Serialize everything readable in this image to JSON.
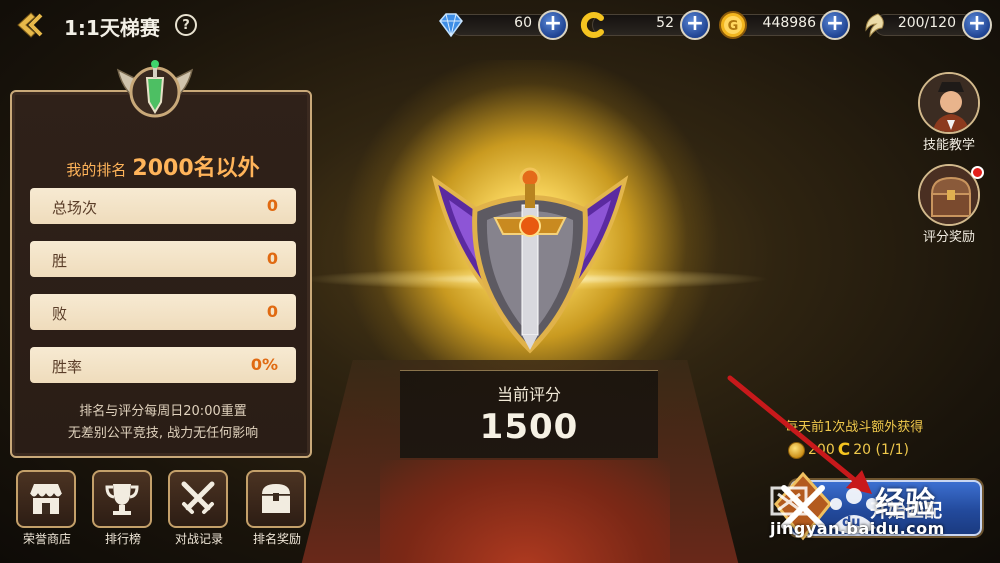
{
  "header": {
    "title": "1:1天梯赛",
    "help_label": "?"
  },
  "resources": [
    {
      "icon": "diamond-icon",
      "value": "60"
    },
    {
      "icon": "c-currency-icon",
      "value": "52"
    },
    {
      "icon": "gold-coin-icon",
      "value": "448986"
    },
    {
      "icon": "wing-stamina-icon",
      "value": "200/120"
    }
  ],
  "panel": {
    "rank_label": "我的排名",
    "rank_value": "2000名以外",
    "stats": [
      {
        "label": "总场次",
        "value": "0"
      },
      {
        "label": "胜",
        "value": "0"
      },
      {
        "label": "败",
        "value": "0"
      },
      {
        "label": "胜率",
        "value": "0%"
      }
    ],
    "notice_line1": "排名与评分每周日20:00重置",
    "notice_line2": "无差别公平竞技, 战力无任何影响"
  },
  "bottom_buttons": [
    {
      "label": "荣誉商店",
      "icon": "shop-icon"
    },
    {
      "label": "排行榜",
      "icon": "trophy-icon"
    },
    {
      "label": "对战记录",
      "icon": "crossed-swords-icon"
    },
    {
      "label": "排名奖励",
      "icon": "treasure-chest-icon"
    }
  ],
  "side_buttons": {
    "skill_tutorial": "技能教学",
    "score_reward": "评分奖励"
  },
  "score": {
    "label": "当前评分",
    "value": "1500"
  },
  "bonus": {
    "text": "每天前1次战斗额外获得",
    "coin_amount": "200",
    "c_amount": "20 (1/1)"
  },
  "match_button": {
    "label": "开始匹配"
  },
  "watermark": {
    "brand": "经验",
    "url": "jingyan.baidu.com"
  },
  "colors": {
    "accent_orange": "#ffb45a",
    "stat_value": "#e06a12",
    "button_blue": "#234a9c",
    "panel_border": "#c9a979",
    "bonus_yellow": "#f0c94c"
  }
}
